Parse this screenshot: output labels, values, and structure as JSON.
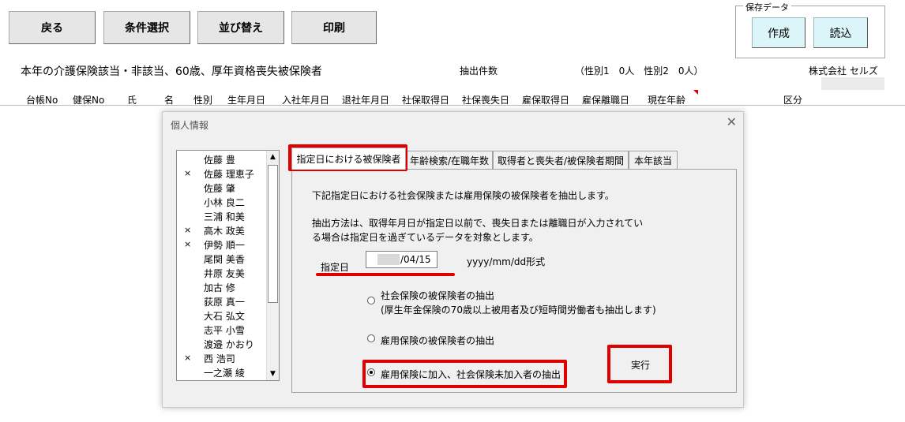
{
  "toolbar": {
    "back": "戻る",
    "condition": "条件選択",
    "sort": "並び替え",
    "print": "印刷"
  },
  "saved_data": {
    "group_label": "保存データ",
    "create": "作成",
    "load": "読込"
  },
  "report": {
    "title": "本年の介護保険該当・非該当、60歳、厚年資格喪失被保険者",
    "count_label": "抽出件数",
    "gender_counts": "（性別1　0人　性別2　0人）",
    "company": "株式会社 セルズ"
  },
  "columns": [
    "台帳No",
    "健保No",
    "氏",
    "名",
    "性別",
    "生年月日",
    "入社年月日",
    "退社年月日",
    "社保取得日",
    "社保喪失日",
    "雇保取得日",
    "雇保離職日",
    "現在年齢",
    "区分"
  ],
  "dialog": {
    "title": "個人情報",
    "close": "✕",
    "persons": [
      {
        "mark": "",
        "name": "佐藤 豊"
      },
      {
        "mark": "×",
        "name": "佐藤 理恵子"
      },
      {
        "mark": "",
        "name": "佐藤 肇"
      },
      {
        "mark": "",
        "name": "小林 良二"
      },
      {
        "mark": "",
        "name": "三浦 和美"
      },
      {
        "mark": "×",
        "name": "高木 政美"
      },
      {
        "mark": "×",
        "name": "伊勢 順一"
      },
      {
        "mark": "",
        "name": "尾関 美香"
      },
      {
        "mark": "",
        "name": "井原 友美"
      },
      {
        "mark": "",
        "name": "加古 修"
      },
      {
        "mark": "",
        "name": "荻原 真一"
      },
      {
        "mark": "",
        "name": "大石 弘文"
      },
      {
        "mark": "",
        "name": "志平 小雪"
      },
      {
        "mark": "",
        "name": "渡邉 かおり"
      },
      {
        "mark": "×",
        "name": "西 浩司"
      },
      {
        "mark": "",
        "name": "一之瀬 綾"
      }
    ],
    "tabs": [
      "指定日における被保険者",
      "年齢検索/在職年数",
      "取得者と喪失者/被保険者期間",
      "本年該当"
    ],
    "panel": {
      "description": "下記指定日における社会保険または雇用保険の被保険者を抽出します。",
      "method_line1": "抽出方法は、取得年月日が指定日以前で、喪失日または離職日が入力されてい",
      "method_line2": "る場合は指定日を過ぎているデータを対象とします。",
      "date_label": "指定日",
      "date_value": "/04/15",
      "date_format": "yyyy/mm/dd形式",
      "option1_line1": "社会保険の被保険者の抽出",
      "option1_line2": "(厚生年金保険の70歳以上被用者及び短時間労働者も抽出します)",
      "option2": "雇用保険の被保険者の抽出",
      "option3": "雇用保険に加入、社会保険未加入者の抽出",
      "selected_option": 3,
      "execute": "実行"
    }
  }
}
